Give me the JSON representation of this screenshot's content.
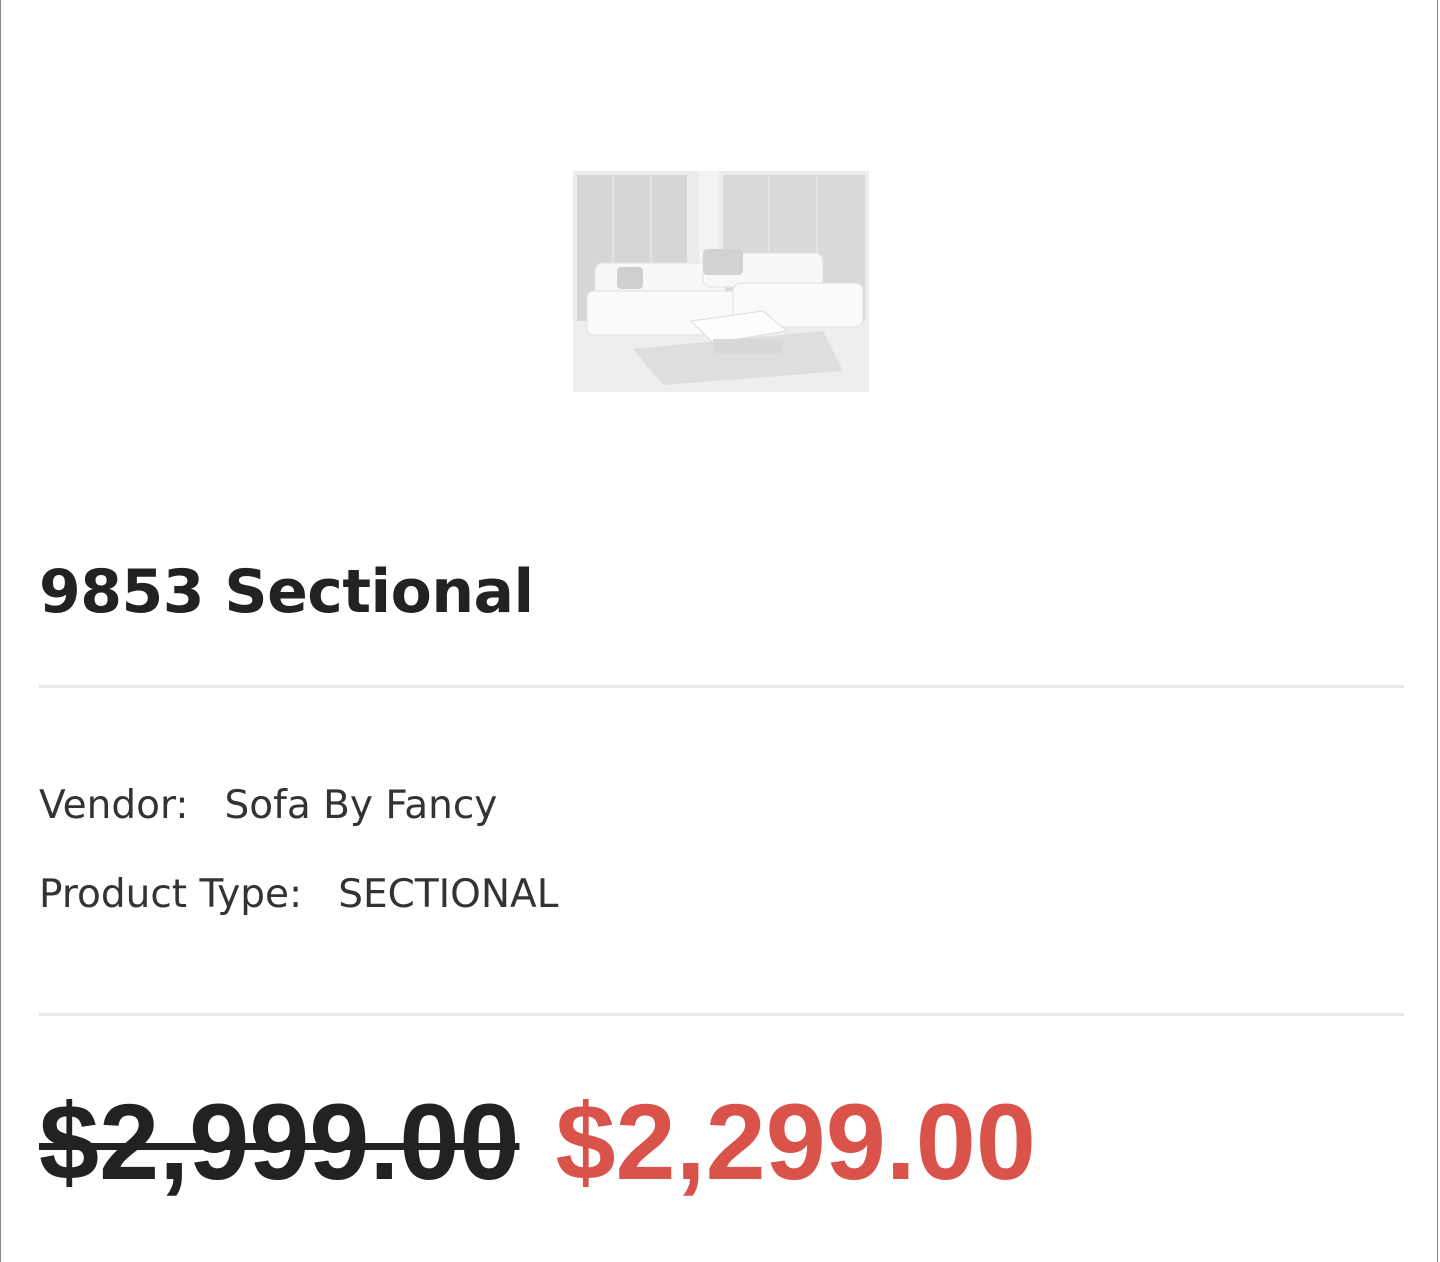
{
  "product": {
    "image_alt": "white sectional sofa in living room",
    "title": "9853 Sectional",
    "vendor_label": "Vendor:",
    "vendor_value": "Sofa By Fancy",
    "type_label": "Product Type:",
    "type_value": "SECTIONAL",
    "price_compare": "$2,999.00",
    "price_sale": "$2,299.00"
  },
  "colors": {
    "sale_price": "#d9534a",
    "text": "#222222",
    "divider": "#e8e8e8"
  }
}
